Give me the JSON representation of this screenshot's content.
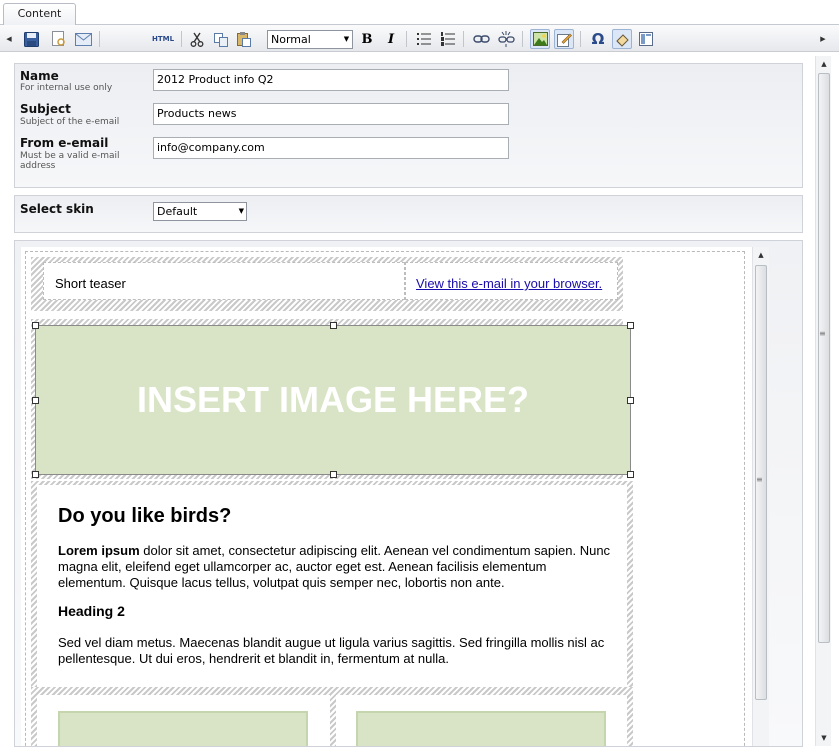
{
  "tabs": [
    {
      "label": "Content"
    }
  ],
  "toolbar": {
    "format_value": "Normal",
    "html_label": "HTML",
    "bold_label": "B",
    "italic_label": "I",
    "omega_label": "Ω"
  },
  "form": {
    "name": {
      "label": "Name",
      "hint": "For internal use only",
      "value": "2012 Product info Q2"
    },
    "subject": {
      "label": "Subject",
      "hint": "Subject of the e-email",
      "value": "Products news"
    },
    "from_email": {
      "label": "From e-email",
      "hint": "Must be a valid e-mail address",
      "value": "info@company.com"
    },
    "skin": {
      "label": "Select skin",
      "value": "Default"
    }
  },
  "email": {
    "teaser": "Short teaser",
    "view_link": "View this e-mail in your browser.",
    "image_placeholder": "INSERT IMAGE HERE?",
    "heading1": "Do you like birds?",
    "para1_bold": "Lorem ipsum",
    "para1_rest": " dolor sit amet, consectetur adipiscing elit. Aenean vel condimentum sapien. Nunc magna elit, eleifend eget ullamcorper ac, auctor eget est. Aenean facilisis elementum elementum. Quisque lacus tellus, volutpat quis semper nec, lobortis non ante.",
    "heading2": "Heading 2",
    "para2": "Sed vel diam metus. Maecenas blandit augue ut ligula varius sagittis. Sed fringilla mollis nisl ac pellentesque. Ut dui eros, hendrerit et blandit in, fermentum at nulla."
  },
  "icons": [
    "save-icon",
    "preview-icon",
    "send-email-icon",
    "html-source-icon",
    "cut-icon",
    "copy-icon",
    "paste-icon",
    "bold-icon",
    "italic-icon",
    "bulleted-list-icon",
    "numbered-list-icon",
    "link-icon",
    "unlink-icon",
    "insert-image-icon",
    "edit-icon",
    "special-character-icon",
    "clear-format-icon",
    "show-blocks-icon"
  ]
}
